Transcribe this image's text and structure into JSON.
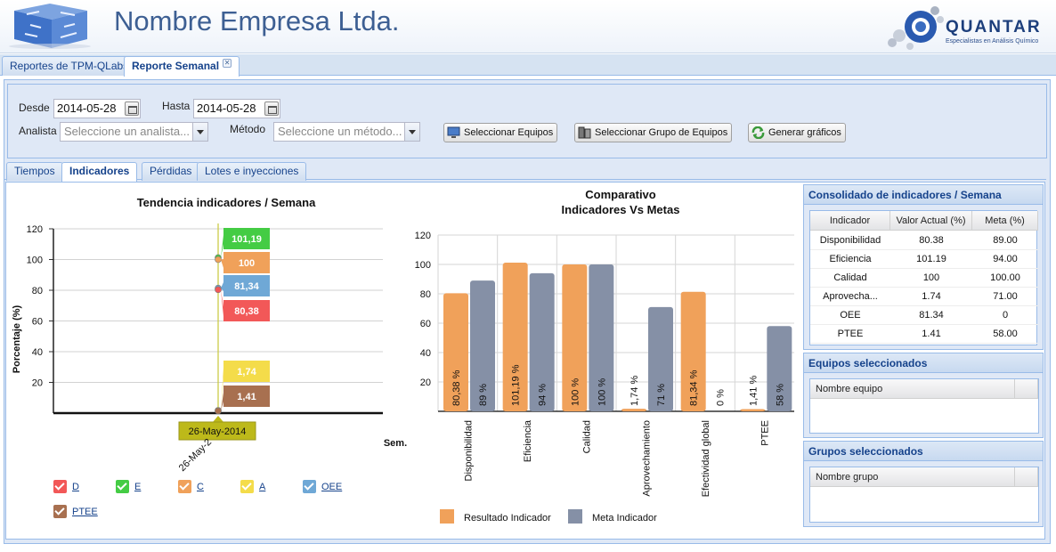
{
  "header": {
    "company_name": "Nombre Empresa Ltda.",
    "brand_name": "QUANTAR",
    "brand_tagline": "Especialistas en Análisis Químico"
  },
  "top_tabs": [
    {
      "label": "Reportes de TPM-QLabs",
      "active": false
    },
    {
      "label": "Reporte Semanal",
      "active": true
    }
  ],
  "filters": {
    "desde_label": "Desde",
    "desde_value": "2014-05-28",
    "hasta_label": "Hasta",
    "hasta_value": "2014-05-28",
    "analista_label": "Analista",
    "analista_placeholder": "Seleccione un analista...",
    "metodo_label": "Método",
    "metodo_placeholder": "Seleccione un método...",
    "btn_equipos": "Seleccionar Equipos",
    "btn_grupo": "Seleccionar Grupo de Equipos",
    "btn_generar": "Generar gráficos"
  },
  "inner_tabs": [
    {
      "label": "Tiempos",
      "active": false
    },
    {
      "label": "Indicadores",
      "active": true
    },
    {
      "label": "Pérdidas",
      "active": false
    },
    {
      "label": "Lotes e inyecciones",
      "active": false
    }
  ],
  "chart_data": [
    {
      "type": "line",
      "title": "Tendencia indicadores / Semana",
      "xlabel": "Sem.",
      "ylabel": "Porcentaje (%)",
      "ylim": [
        0,
        120
      ],
      "yticks": [
        20,
        40,
        60,
        80,
        100,
        120
      ],
      "categories": [
        "26-May-2014"
      ],
      "x_tick_label": "26-May-2",
      "tooltip_label": "26-May-2014",
      "series": [
        {
          "name": "E",
          "values": [
            101.19
          ],
          "label": "101,19",
          "color": "#44cc44"
        },
        {
          "name": "C",
          "values": [
            100
          ],
          "label": "100",
          "color": "#f0a15a"
        },
        {
          "name": "OEE",
          "values": [
            81.34
          ],
          "label": "81,34",
          "color": "#6fa8d6"
        },
        {
          "name": "D",
          "values": [
            80.38
          ],
          "label": "80,38",
          "color": "#f25858"
        },
        {
          "name": "A",
          "values": [
            1.74
          ],
          "label": "1,74",
          "color": "#f4dc4a"
        },
        {
          "name": "PTEE",
          "values": [
            1.41
          ],
          "label": "1,41",
          "color": "#a87050"
        }
      ],
      "legend": [
        {
          "name": "D",
          "color": "#f25858"
        },
        {
          "name": "E",
          "color": "#44cc44"
        },
        {
          "name": "C",
          "color": "#f0a15a"
        },
        {
          "name": "A",
          "color": "#f4dc4a"
        },
        {
          "name": "OEE",
          "color": "#6fa8d6"
        },
        {
          "name": "PTEE",
          "color": "#a87050"
        }
      ]
    },
    {
      "type": "bar",
      "title": "Comparativo",
      "subtitle": "Indicadores Vs Metas",
      "ylim": [
        0,
        120
      ],
      "yticks": [
        20,
        40,
        60,
        80,
        100,
        120
      ],
      "categories": [
        "Disponibilidad",
        "Eficiencia",
        "Calidad",
        "Aprovechamiento",
        "Efectividad global",
        "PTEE"
      ],
      "series": [
        {
          "name": "Resultado Indicador",
          "color": "#f0a15a",
          "values": [
            80.38,
            101.19,
            100,
            1.74,
            81.34,
            1.41
          ],
          "labels": [
            "80,38 %",
            "101,19 %",
            "100 %",
            "1,74 %",
            "81,34 %",
            "1,41 %"
          ]
        },
        {
          "name": "Meta Indicador",
          "color": "#8590a6",
          "values": [
            89,
            94,
            100,
            71,
            0,
            58
          ],
          "labels": [
            "89 %",
            "94 %",
            "100 %",
            "71 %",
            "0 %",
            "58 %"
          ]
        }
      ]
    }
  ],
  "consolidado": {
    "title": "Consolidado de indicadores / Semana",
    "columns": [
      "Indicador",
      "Valor Actual (%)",
      "Meta (%)"
    ],
    "rows": [
      [
        "Disponibilidad",
        "80.38",
        "89.00"
      ],
      [
        "Eficiencia",
        "101.19",
        "94.00"
      ],
      [
        "Calidad",
        "100",
        "100.00"
      ],
      [
        "Aprovecha...",
        "1.74",
        "71.00"
      ],
      [
        "OEE",
        "81.34",
        "0"
      ],
      [
        "PTEE",
        "1.41",
        "58.00"
      ]
    ]
  },
  "equipos": {
    "title": "Equipos seleccionados",
    "column": "Nombre equipo"
  },
  "grupos": {
    "title": "Grupos seleccionados",
    "column": "Nombre grupo"
  }
}
